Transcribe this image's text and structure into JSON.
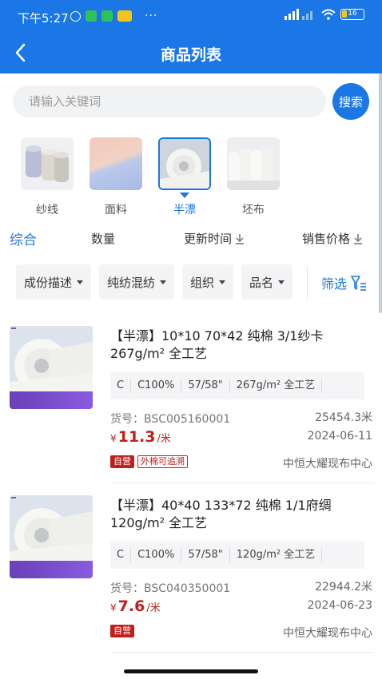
{
  "status_bar": {
    "time": "下午5:27",
    "battery": "16"
  },
  "header": {
    "title": "商品列表"
  },
  "search": {
    "placeholder": "请输入关键词",
    "button_label": "搜索"
  },
  "categories": [
    {
      "label": "纱线",
      "active": false
    },
    {
      "label": "面料",
      "active": false
    },
    {
      "label": "半漂",
      "active": true
    },
    {
      "label": "坯布",
      "active": false
    }
  ],
  "sort": {
    "comprehensive": "综合",
    "quantity": "数量",
    "update_time": "更新时间",
    "price": "销售价格"
  },
  "filters": {
    "chips": [
      "成份描述",
      "纯纺混纺",
      "组织",
      "品名"
    ],
    "filter_label": "筛选"
  },
  "products": [
    {
      "title": "【半漂】10*10 70*42 纯棉 3/1纱卡 267g/m² 全工艺",
      "specs": [
        "C",
        "C100%",
        "57/58\"",
        "267g/m² 全工艺"
      ],
      "code": "货号：BSC005160001",
      "quantity": "25454.3米",
      "price_currency": "¥",
      "price": "11.3",
      "price_unit": "/米",
      "date": "2024-06-11",
      "badges": [
        "自营",
        "外棉可追溯"
      ],
      "seller": "中恒大耀现布中心"
    },
    {
      "title": "【半漂】40*40 133*72 纯棉 1/1府绸 120g/m² 全工艺",
      "specs": [
        "C",
        "C100%",
        "57/58\"",
        "120g/m² 全工艺"
      ],
      "code": "货号：BSC040350001",
      "quantity": "22944.2米",
      "price_currency": "¥",
      "price": "7.6",
      "price_unit": "/米",
      "date": "2024-06-23",
      "badges": [
        "自营"
      ],
      "seller": "中恒大耀现布中心"
    }
  ],
  "colors": {
    "primary": "#1a77e5",
    "price_red": "#c0201a"
  }
}
